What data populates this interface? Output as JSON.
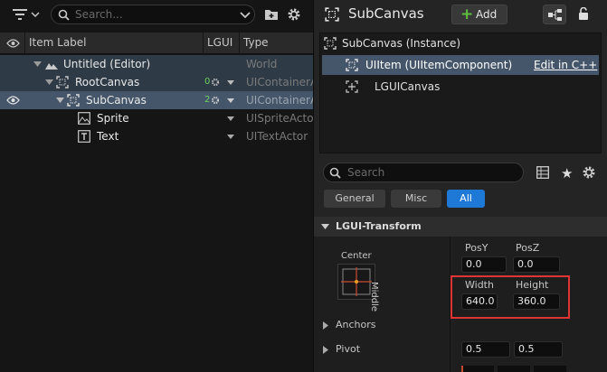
{
  "outliner": {
    "search_placeholder": "Search...",
    "columns": {
      "label": "Item Label",
      "lgui": "LGUI",
      "type": "Type"
    },
    "rows": [
      {
        "name": "Untitled (Editor)",
        "type": "World"
      },
      {
        "name": "RootCanvas",
        "lgui": "0",
        "type": "UIContainerA"
      },
      {
        "name": "SubCanvas",
        "lgui": "2",
        "type": "UIContainerA"
      },
      {
        "name": "Sprite",
        "type": "UISpriteActo"
      },
      {
        "name": "Text",
        "type": "UITextActor"
      }
    ]
  },
  "details": {
    "title": "SubCanvas",
    "add_label": "Add",
    "components": [
      {
        "label": "SubCanvas (Instance)"
      },
      {
        "label": "UIItem (UIItemComponent)",
        "link": "Edit in C++"
      },
      {
        "label": "LGUICanvas"
      }
    ],
    "search_placeholder": "Search",
    "tabs": [
      "General",
      "Misc",
      "All"
    ],
    "active_tab": "All",
    "section_title": "LGUI-Transform",
    "anchor_widget": {
      "top_label": "Center",
      "side_label": "Middle"
    },
    "fields": {
      "posy": {
        "label": "PosY",
        "value": "0.0"
      },
      "posz": {
        "label": "PosZ",
        "value": "0.0"
      },
      "width": {
        "label": "Width",
        "value": "640.0"
      },
      "height": {
        "label": "Height",
        "value": "360.0"
      }
    },
    "anchors_label": "Anchors",
    "pivot_label": "Pivot",
    "pivot_values": [
      "0.5",
      "0.5"
    ],
    "highlight_color": "#e03333"
  }
}
